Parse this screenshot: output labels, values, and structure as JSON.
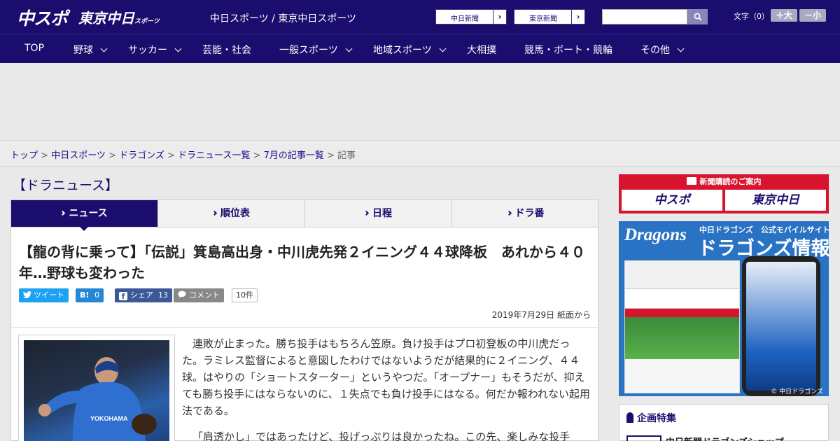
{
  "header": {
    "logo1": "中スポ",
    "logo2": "東京中日",
    "logo2_sub": "スポーツ",
    "site_name": "中日スポーツ / 東京中日スポーツ",
    "link1": "中日新聞",
    "link2": "東京新聞",
    "font_label": "文字（0）",
    "font_up": "＋大",
    "font_down": "－小",
    "search_placeholder": ""
  },
  "nav": {
    "items": [
      "TOP",
      "野球",
      "サッカー",
      "芸能・社会",
      "一般スポーツ",
      "地域スポーツ",
      "大相撲",
      "競馬・ボート・競輪",
      "その他"
    ]
  },
  "breadcrumb": {
    "items": [
      "トップ",
      "中日スポーツ",
      "ドラゴンズ",
      "ドラニュース一覧",
      "7月の記事一覧"
    ],
    "current": "記事",
    "separator": " > "
  },
  "section_title": "【ドラニュース】",
  "tabs": [
    "ニュース",
    "順位表",
    "日程",
    "ドラ番"
  ],
  "article": {
    "headline": "【龍の背に乗って】「伝説」箕島高出身・中川虎先発２イニング４４球降板　あれから４０年…野球も変わった",
    "share": {
      "tweet": "ツイート",
      "hatena": "B!",
      "hatena_count": "0",
      "facebook": "シェア",
      "facebook_count": "13",
      "comment": "コメント",
      "comment_count": "10件"
    },
    "date": "2019年7月29日 紙面から",
    "paragraphs": [
      "連敗が止まった。勝ち投手はもちろん笠原。負け投手はプロ初登板の中川虎だった。ラミレス監督によると意図したわけではないようだが結果的に２イニング、４４球。はやりの「ショートスターター」というやつだ。「オープナー」もそうだが、抑えても勝ち投手にはならないのに、１失点でも負け投手にはなる。何だか報われない起用法である。",
      "「肩透かし」ではあったけど、投げっぷりは良かったね。この先、楽しみな投手"
    ]
  },
  "sidebar": {
    "subscribe_label": "新聞購読のご案内",
    "subscribe_btn1": "中スポ",
    "subscribe_btn2": "東京中日",
    "dragons_brand": "Dragons",
    "dragons_tag": "中日ドラゴンズ　公式モバイルサイト",
    "dragons_title": "ドラゴンズ情報",
    "copyright": "© 中日ドラゴンズ",
    "feature_title": "企画特集",
    "feature_item": "中日新聞ドラゴンズショップ"
  },
  "colors": {
    "brand_navy": "#1a0d6e",
    "twitter": "#1da1f2",
    "hatena": "#2488d4",
    "facebook": "#3b5998",
    "comment": "#888888",
    "subscribe_red": "#d7132e"
  }
}
